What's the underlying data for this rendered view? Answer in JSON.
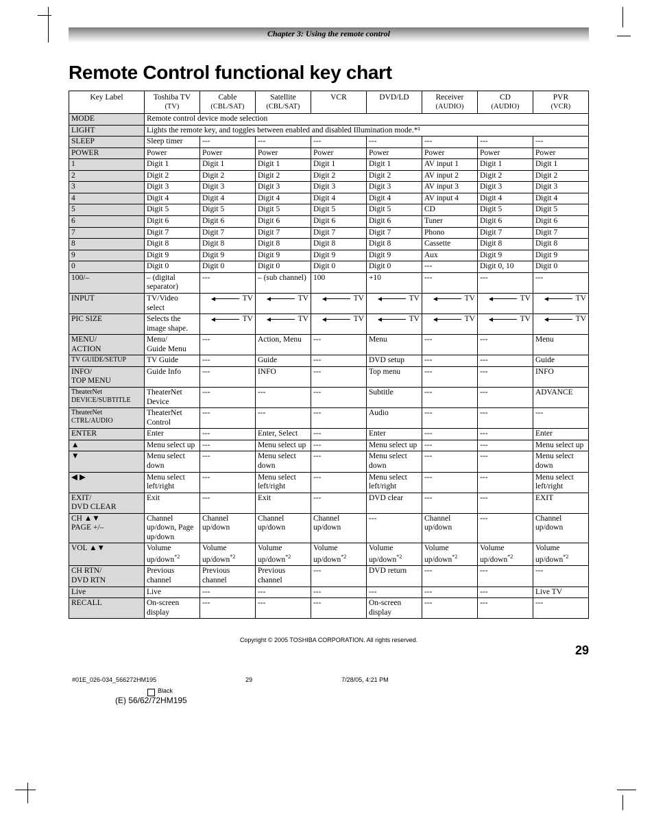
{
  "chapter_header": "Chapter 3: Using the remote control",
  "title": "Remote Control functional key chart",
  "columns": [
    {
      "head": "Key Label",
      "sub": ""
    },
    {
      "head": "Toshiba TV",
      "sub": "(TV)"
    },
    {
      "head": "Cable",
      "sub": "(CBL/SAT)"
    },
    {
      "head": "Satellite",
      "sub": "(CBL/SAT)"
    },
    {
      "head": "VCR",
      "sub": ""
    },
    {
      "head": "DVD/LD",
      "sub": ""
    },
    {
      "head": "Receiver",
      "sub": "(AUDIO)"
    },
    {
      "head": "CD",
      "sub": "(AUDIO)"
    },
    {
      "head": "PVR",
      "sub": "(VCR)"
    }
  ],
  "rows": [
    {
      "label": "MODE",
      "span": "Remote control device mode selection"
    },
    {
      "label": "LIGHT",
      "span": "Lights the remote key, and toggles between enabled and disabled Illumination mode.*¹"
    },
    {
      "label": "SLEEP",
      "cells": [
        "Sleep timer",
        "---",
        "---",
        "---",
        "---",
        "---",
        "---",
        "---"
      ]
    },
    {
      "label": "POWER",
      "cells": [
        "Power",
        "Power",
        "Power",
        "Power",
        "Power",
        "Power",
        "Power",
        "Power"
      ]
    },
    {
      "label": "1",
      "cells": [
        "Digit 1",
        "Digit 1",
        "Digit 1",
        "Digit 1",
        "Digit 1",
        "AV input 1",
        "Digit 1",
        "Digit 1"
      ]
    },
    {
      "label": "2",
      "cells": [
        "Digit 2",
        "Digit 2",
        "Digit 2",
        "Digit 2",
        "Digit 2",
        "AV input 2",
        "Digit 2",
        "Digit 2"
      ]
    },
    {
      "label": "3",
      "cells": [
        "Digit 3",
        "Digit 3",
        "Digit 3",
        "Digit 3",
        "Digit 3",
        "AV input 3",
        "Digit 3",
        "Digit 3"
      ]
    },
    {
      "label": "4",
      "cells": [
        "Digit 4",
        "Digit 4",
        "Digit 4",
        "Digit 4",
        "Digit 4",
        "AV input 4",
        "Digit 4",
        "Digit 4"
      ]
    },
    {
      "label": "5",
      "cells": [
        "Digit 5",
        "Digit 5",
        "Digit 5",
        "Digit 5",
        "Digit 5",
        "CD",
        "Digit 5",
        "Digit 5"
      ]
    },
    {
      "label": "6",
      "cells": [
        "Digit 6",
        "Digit 6",
        "Digit 6",
        "Digit 6",
        "Digit 6",
        "Tuner",
        "Digit 6",
        "Digit 6"
      ]
    },
    {
      "label": "7",
      "cells": [
        "Digit 7",
        "Digit 7",
        "Digit 7",
        "Digit 7",
        "Digit 7",
        "Phono",
        "Digit 7",
        "Digit 7"
      ]
    },
    {
      "label": "8",
      "cells": [
        "Digit 8",
        "Digit 8",
        "Digit 8",
        "Digit 8",
        "Digit 8",
        "Cassette",
        "Digit 8",
        "Digit 8"
      ]
    },
    {
      "label": "9",
      "cells": [
        "Digit 9",
        "Digit 9",
        "Digit 9",
        "Digit 9",
        "Digit 9",
        "Aux",
        "Digit 9",
        "Digit 9"
      ]
    },
    {
      "label": "0",
      "cells": [
        "Digit 0",
        "Digit 0",
        "Digit 0",
        "Digit 0",
        "Digit 0",
        "---",
        "Digit 0, 10",
        "Digit 0"
      ]
    },
    {
      "label": "100/–",
      "cells": [
        "– (digital separator)",
        "---",
        "– (sub channel)",
        "100",
        "+10",
        "---",
        "---",
        "---"
      ]
    },
    {
      "label": "INPUT",
      "cells": [
        "TV/Video select",
        "ARROW_TV",
        "ARROW_TV",
        "ARROW_TV",
        "ARROW_TV",
        "ARROW_TV",
        "ARROW_TV",
        "ARROW_TV"
      ]
    },
    {
      "label": "PIC SIZE",
      "cells": [
        "Selects the image shape.",
        "ARROW_TV",
        "ARROW_TV",
        "ARROW_TV",
        "ARROW_TV",
        "ARROW_TV",
        "ARROW_TV",
        "ARROW_TV"
      ]
    },
    {
      "label": "MENU/\nACTION",
      "cells": [
        "Menu/\nGuide Menu",
        "---",
        "Action, Menu",
        "---",
        "Menu",
        "---",
        "---",
        "Menu"
      ]
    },
    {
      "label": "TV GUIDE/SETUP",
      "small": true,
      "cells": [
        "TV Guide",
        "---",
        "Guide",
        "---",
        "DVD setup",
        "---",
        "---",
        "Guide"
      ]
    },
    {
      "label": "INFO/\nTOP MENU",
      "cells": [
        "Guide Info",
        "---",
        "INFO",
        "---",
        "Top menu",
        "---",
        "---",
        "INFO"
      ]
    },
    {
      "label": "TheaterNet DEVICE/SUBTITLE",
      "small": true,
      "cells": [
        "TheaterNet Device",
        "---",
        "---",
        "---",
        "Subtitle",
        "---",
        "---",
        "ADVANCE"
      ]
    },
    {
      "label": "TheaterNet CTRL/AUDIO",
      "small": true,
      "cells": [
        "TheaterNet Control",
        "---",
        "---",
        "---",
        "Audio",
        "---",
        "---",
        "---"
      ]
    },
    {
      "label": "ENTER",
      "cells": [
        "Enter",
        "---",
        "Enter, Select",
        "---",
        "Enter",
        "---",
        "---",
        "Enter"
      ]
    },
    {
      "label": "▲",
      "tri": true,
      "cells": [
        "Menu select up",
        "---",
        "Menu select up",
        "---",
        "Menu select up",
        "---",
        "---",
        "Menu select up"
      ]
    },
    {
      "label": "▼",
      "tri": true,
      "cells": [
        "Menu select down",
        "---",
        "Menu select down",
        "---",
        "Menu select down",
        "---",
        "---",
        "Menu select down"
      ]
    },
    {
      "label": "◀ ▶",
      "tri": true,
      "cells": [
        "Menu select left/right",
        "---",
        "Menu select left/right",
        "---",
        "Menu select left/right",
        "---",
        "---",
        "Menu select left/right"
      ]
    },
    {
      "label": "EXIT/\nDVD CLEAR",
      "cells": [
        "Exit",
        "---",
        "Exit",
        "---",
        "DVD clear",
        "---",
        "---",
        "EXIT"
      ]
    },
    {
      "label": "CH ▲▼\nPAGE +/–",
      "cells": [
        "Channel up/down, Page up/down",
        "Channel up/down",
        "Channel up/down",
        "Channel up/down",
        "---",
        "Channel up/down",
        "---",
        "Channel up/down"
      ]
    },
    {
      "label": "VOL ▲▼",
      "cells": [
        "Volume up/down*²",
        "Volume up/down*²",
        "Volume up/down*²",
        "Volume up/down*²",
        "Volume up/down*²",
        "Volume up/down*²",
        "Volume up/down*²",
        "Volume up/down*²"
      ]
    },
    {
      "label": "CH RTN/\nDVD RTN",
      "cells": [
        "Previous channel",
        "Previous channel",
        "Previous channel",
        "---",
        "DVD return",
        "---",
        "---",
        "---"
      ]
    },
    {
      "label": "Live",
      "cells": [
        "Live",
        "---",
        "---",
        "---",
        "---",
        "---",
        "---",
        "Live TV"
      ]
    },
    {
      "label": "RECALL",
      "cells": [
        "On-screen display",
        "---",
        "---",
        "---",
        "On-screen display",
        "---",
        "---",
        "---"
      ]
    }
  ],
  "footer": {
    "copyright": "Copyright © 2005 TOSHIBA CORPORATION. All rights reserved.",
    "page_number": "29",
    "jobcode": "#01E_026-034_566272HM195",
    "small_page": "29",
    "timestamp": "7/28/05, 4:21 PM",
    "color": "Black",
    "model": "(E) 56/62/72HM195"
  },
  "tv_label": "TV"
}
